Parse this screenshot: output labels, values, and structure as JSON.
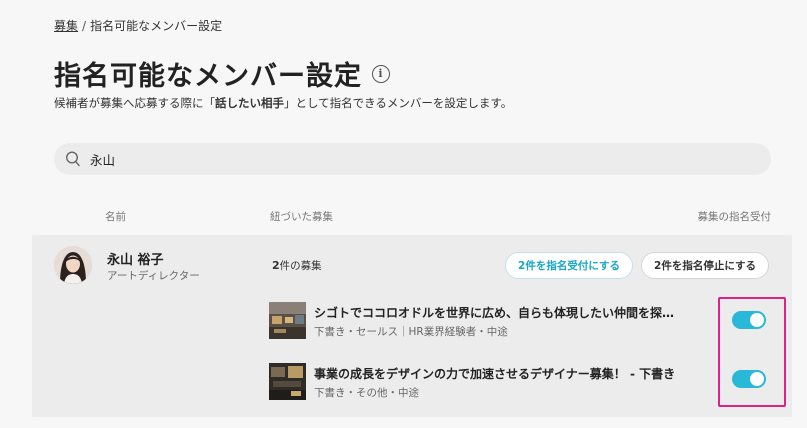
{
  "breadcrumb": {
    "parent": "募集",
    "separator": "/",
    "current": "指名可能なメンバー設定"
  },
  "page": {
    "title": "指名可能なメンバー設定",
    "info_icon_glyph": "i",
    "description_before": "候補者が募集へ応募する際に「",
    "description_bold": "話したい相手",
    "description_after": "」として指名できるメンバーを設定します。"
  },
  "search": {
    "value": "永山",
    "icon": "search-icon"
  },
  "columns": {
    "name": "名前",
    "jobs": "紐づいた募集",
    "accept": "募集の指名受付"
  },
  "member": {
    "name": "永山 裕子",
    "role": "アートディレクター",
    "job_count_number": "2",
    "job_count_suffix": "件の募集",
    "accept_all_label": "2件を指名受付にする",
    "stop_all_label": "2件を指名停止にする",
    "jobs": [
      {
        "title": "シゴトでココロオドルを世界に広め、自らも体現したい仲間を探…",
        "meta": "下書き・セールス｜HR業界経験者・中途",
        "accepting": true
      },
      {
        "title": "事業の成長をデザインの力で加速させるデザイナー募集！ - 下書き",
        "meta": "下書き・その他・中途",
        "accepting": true
      }
    ]
  },
  "colors": {
    "accent": "#29b8d8",
    "highlight": "#e0218a"
  }
}
